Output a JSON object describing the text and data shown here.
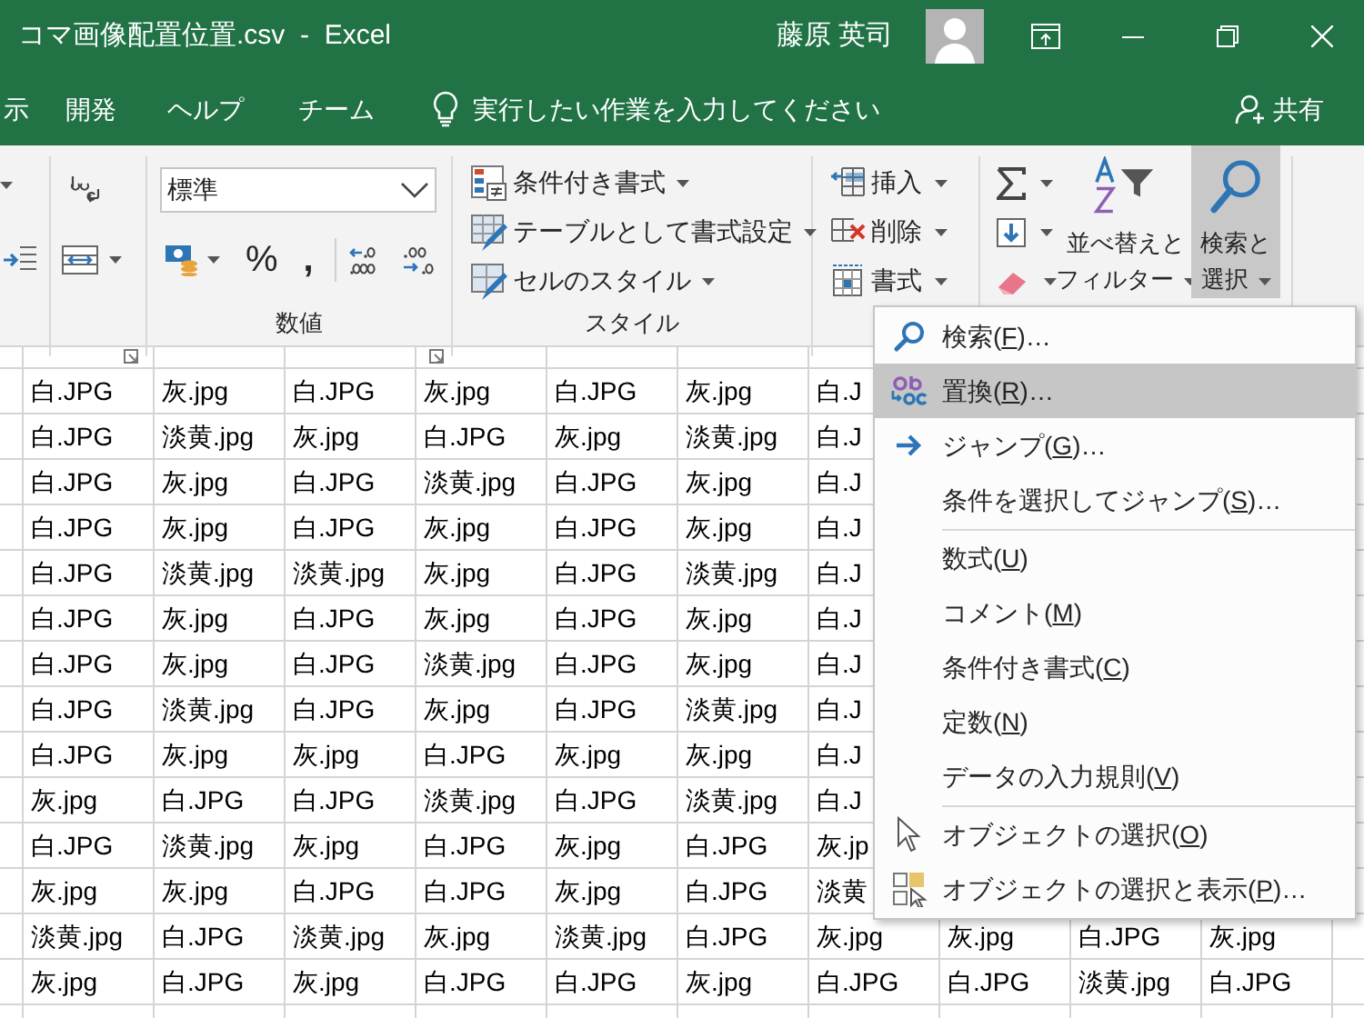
{
  "window": {
    "title": "コマ画像配置位置.csv  -  Excel",
    "user": "藤原 英司"
  },
  "tabs": [
    {
      "label": "示",
      "selected": false
    },
    {
      "label": "開発",
      "selected": false
    },
    {
      "label": "ヘルプ",
      "selected": false
    },
    {
      "label": "チーム",
      "selected": false
    }
  ],
  "tell_me": {
    "placeholder": "実行したい作業を入力してください"
  },
  "share": {
    "label": "共有"
  },
  "ribbon": {
    "number_format": {
      "value": "標準"
    },
    "number_buttons": [
      "%",
      ","
    ],
    "number_group_label": "数値",
    "styles": [
      {
        "label": "条件付き書式"
      },
      {
        "label": "テーブルとして書式設定"
      },
      {
        "label": "セルのスタイル"
      }
    ],
    "styles_group_label": "スタイル",
    "cells": [
      {
        "label": "挿入"
      },
      {
        "label": "削除"
      },
      {
        "label": "書式"
      }
    ],
    "sort_filter": {
      "label": "並べ替えとフィルター",
      "pressed": false
    },
    "find_select": {
      "label": "検索と選択",
      "pressed": true
    }
  },
  "menu": {
    "groups": [
      [
        {
          "kind": "search",
          "label": "検索(F)…",
          "selected": false
        },
        {
          "kind": "replace",
          "label": "置換(R)…",
          "selected": true
        },
        {
          "kind": "goto",
          "label": "ジャンプ(G)…",
          "selected": false
        },
        {
          "kind": "plain",
          "label": "条件を選択してジャンプ(S)…",
          "selected": false
        }
      ],
      [
        {
          "kind": "plain",
          "label": "数式(U)",
          "selected": false
        },
        {
          "kind": "plain",
          "label": "コメント(M)",
          "selected": false
        },
        {
          "kind": "plain",
          "label": "条件付き書式(C)",
          "selected": false
        },
        {
          "kind": "plain",
          "label": "定数(N)",
          "selected": false
        },
        {
          "kind": "plain",
          "label": "データの入力規則(V)",
          "selected": false
        }
      ],
      [
        {
          "kind": "pointer",
          "label": "オブジェクトの選択(O)",
          "selected": false
        },
        {
          "kind": "pane",
          "label": "オブジェクトの選択と表示(P)…",
          "selected": false
        }
      ]
    ]
  },
  "sheet": {
    "rows": [
      [
        "白.JPG",
        "灰.jpg",
        "白.JPG",
        "灰.jpg",
        "白.JPG",
        "灰.jpg",
        "白.J"
      ],
      [
        "白.JPG",
        "淡黄.jpg",
        "灰.jpg",
        "白.JPG",
        "灰.jpg",
        "淡黄.jpg",
        "白.J"
      ],
      [
        "白.JPG",
        "灰.jpg",
        "白.JPG",
        "淡黄.jpg",
        "白.JPG",
        "灰.jpg",
        "白.J"
      ],
      [
        "白.JPG",
        "灰.jpg",
        "白.JPG",
        "灰.jpg",
        "白.JPG",
        "灰.jpg",
        "白.J"
      ],
      [
        "白.JPG",
        "淡黄.jpg",
        "淡黄.jpg",
        "灰.jpg",
        "白.JPG",
        "淡黄.jpg",
        "白.J"
      ],
      [
        "白.JPG",
        "灰.jpg",
        "白.JPG",
        "灰.jpg",
        "白.JPG",
        "灰.jpg",
        "白.J"
      ],
      [
        "白.JPG",
        "灰.jpg",
        "白.JPG",
        "淡黄.jpg",
        "白.JPG",
        "灰.jpg",
        "白.J"
      ],
      [
        "白.JPG",
        "淡黄.jpg",
        "白.JPG",
        "灰.jpg",
        "白.JPG",
        "淡黄.jpg",
        "白.J"
      ],
      [
        "白.JPG",
        "灰.jpg",
        "灰.jpg",
        "白.JPG",
        "灰.jpg",
        "灰.jpg",
        "白.J"
      ],
      [
        "灰.jpg",
        "白.JPG",
        "白.JPG",
        "淡黄.jpg",
        "白.JPG",
        "淡黄.jpg",
        "白.J"
      ],
      [
        "白.JPG",
        "淡黄.jpg",
        "灰.jpg",
        "白.JPG",
        "灰.jpg",
        "白.JPG",
        "灰.jp"
      ],
      [
        "灰.jpg",
        "灰.jpg",
        "白.JPG",
        "白.JPG",
        "灰.jpg",
        "白.JPG",
        "淡黄"
      ],
      [
        "淡黄.jpg",
        "白.JPG",
        "淡黄.jpg",
        "灰.jpg",
        "淡黄.jpg",
        "白.JPG",
        "灰.jpg",
        "灰.jpg",
        "白.JPG",
        "灰.jpg"
      ],
      [
        "灰.jpg",
        "白.JPG",
        "灰.jpg",
        "白.JPG",
        "白.JPG",
        "灰.jpg",
        "白.JPG",
        "白.JPG",
        "淡黄.jpg",
        "白.JPG"
      ]
    ]
  }
}
